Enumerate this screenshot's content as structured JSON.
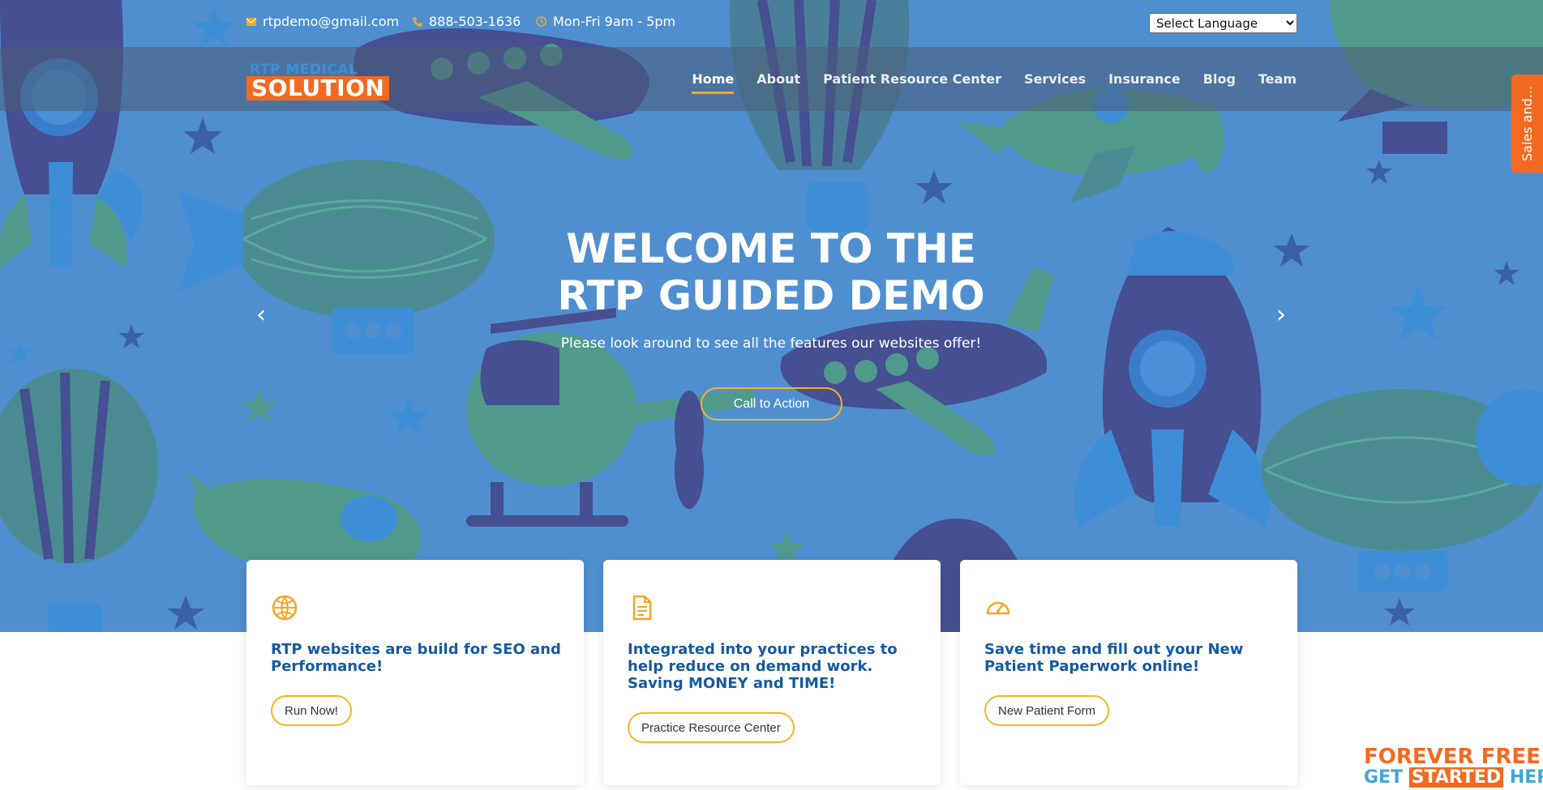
{
  "topbar": {
    "email": "rtpdemo@gmail.com",
    "phone": "888-503-1636",
    "hours": "Mon-Fri 9am - 5pm",
    "language_select": "Select Language"
  },
  "logo": {
    "top_text": "RTP MEDICAL",
    "main_text": "SOLUTION"
  },
  "nav": {
    "items": [
      "Home",
      "About",
      "Patient Resource Center",
      "Services",
      "Insurance",
      "Blog",
      "Team"
    ],
    "active": "Home"
  },
  "side_tab": {
    "label": "Sales and..."
  },
  "hero": {
    "title_line1": "WELCOME TO THE",
    "title_line2": "RTP GUIDED DEMO",
    "subtitle": "Please look around to see all the features our websites offer!",
    "cta_label": "Call to Action",
    "prev_arrow": "‹",
    "next_arrow": "›"
  },
  "cards": [
    {
      "icon": "basketball-icon",
      "title": "RTP websites are build for SEO and Performance!",
      "button": "Run Now!"
    },
    {
      "icon": "document-icon",
      "title": "Integrated into your practices to help reduce on demand work. Saving MONEY and TIME!",
      "button": "Practice Resource Center"
    },
    {
      "icon": "speedometer-icon",
      "title": "Save time and fill out your New Patient Paperwork online!",
      "button": "New Patient Form"
    }
  ],
  "badge": {
    "line1": "FOREVER FREE",
    "line2_a": "GET",
    "line2_b": "STARTED",
    "line2_c": "HERE"
  },
  "colors": {
    "hero_bg": "#4f8fd0",
    "accent_orange": "#f26a21",
    "accent_yellow": "#f5b41d",
    "title_blue": "#165aa0"
  }
}
